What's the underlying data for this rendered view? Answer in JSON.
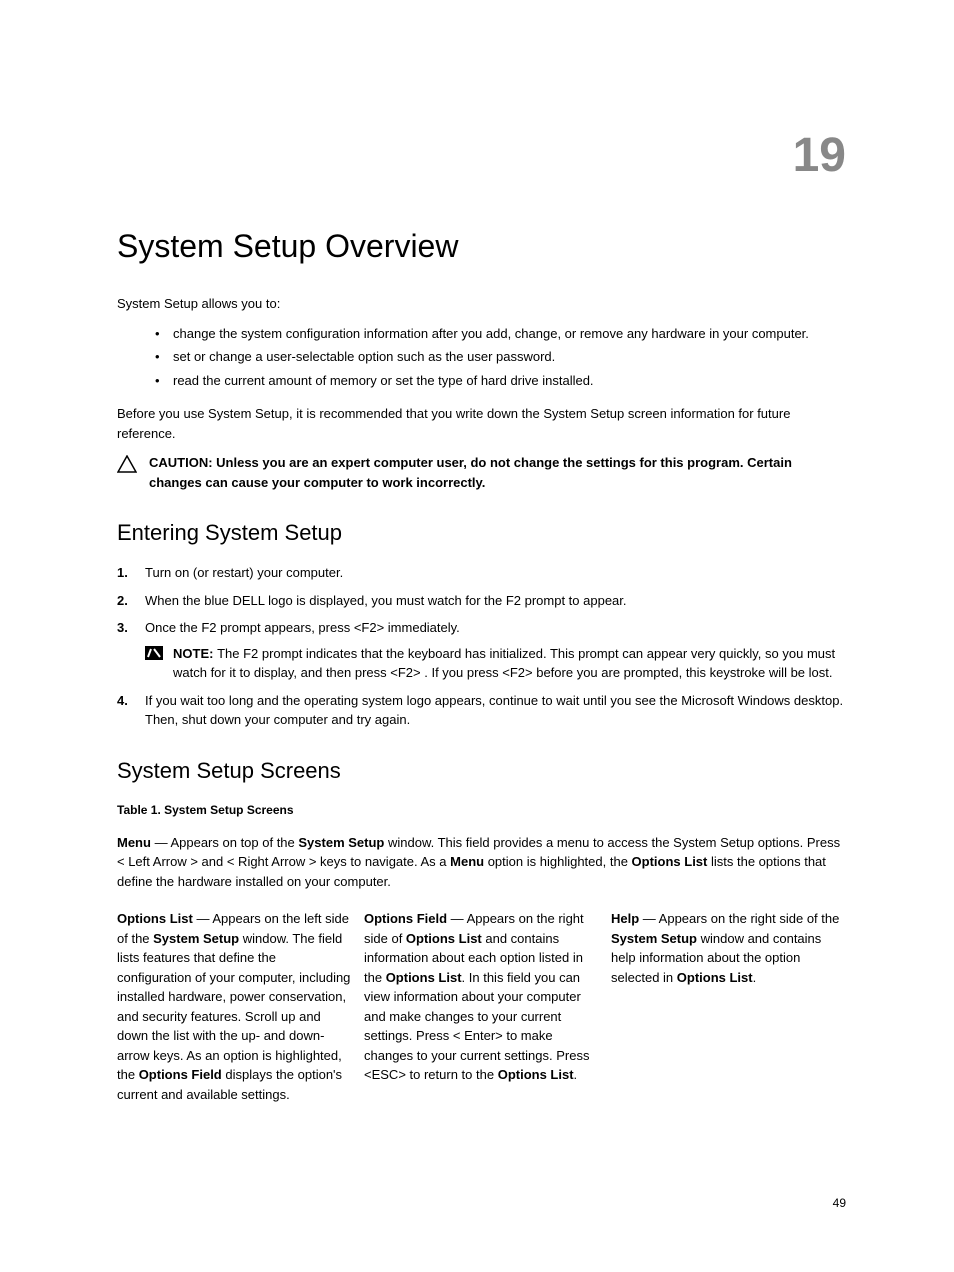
{
  "chapter_number": "19",
  "title": "System Setup Overview",
  "intro": "System Setup allows you to:",
  "bullets": [
    "change the system configuration information after you add, change, or remove any hardware in your computer.",
    "set or change a user-selectable option such as the user password.",
    "read the current amount of memory or set the type of hard drive installed."
  ],
  "before_para": "Before you use System Setup, it is recommended that you write down the System Setup screen information for future reference.",
  "caution": "CAUTION: Unless you are an expert computer user, do not change the settings for this program. Certain changes can cause your computer to work incorrectly.",
  "section_entering": {
    "heading": "Entering System Setup",
    "step1": "Turn on (or restart) your computer.",
    "step2": "When the blue DELL logo is displayed, you must watch for the F2 prompt to appear.",
    "step3": "Once the F2 prompt appears, press <F2> immediately.",
    "note_prefix": "NOTE: ",
    "note_body": "The F2 prompt indicates that the keyboard has initialized. This prompt can appear very quickly, so you must watch for it to display, and then press <F2> . If you press <F2> before you are prompted, this keystroke will be lost.",
    "step4": "If you wait too long and the operating system logo appears, continue to wait until you see the Microsoft Windows desktop. Then, shut down your computer and try again."
  },
  "section_screens": {
    "heading": "System Setup Screens",
    "table_label": "Table 1. System Setup Screens",
    "menu": {
      "b1": "Menu",
      "t1": " — Appears on top of the ",
      "b2": "System Setup",
      "t2": " window. This field provides a menu to access the System Setup options. Press < Left Arrow > and < Right Arrow > keys to navigate. As a ",
      "b3": "Menu",
      "t3": " option is highlighted, the ",
      "b4": "Options List",
      "t4": " lists the options that define the hardware installed on your computer."
    },
    "col1": {
      "b1": "Options List",
      "t1": " — Appears on the left side of the ",
      "b2": "System Setup",
      "t2": " window. The field lists features that define the configuration of your computer, including installed hardware, power conservation, and security features. Scroll up and down the list with the up- and down-arrow keys. As an option is highlighted, the ",
      "b3": "Options Field",
      "t3": " displays the option's current and available settings."
    },
    "col2": {
      "b1": "Options Field",
      "t1": " — Appears on the right side of ",
      "b2": "Options List",
      "t2": " and contains information about each option listed in the ",
      "b3": "Options List",
      "t3": ". In this field you can view information about your computer and make changes to your current settings. Press < Enter> to make changes to your current settings. Press <ESC> to return to the ",
      "b4": "Options List",
      "t4": "."
    },
    "col3": {
      "b1": "Help",
      "t1": " — Appears on the right side of the ",
      "b2": "System Setup",
      "t2": " window and contains help information about the option selected in ",
      "b3": "Options List",
      "t3": "."
    }
  },
  "page_number": "49"
}
